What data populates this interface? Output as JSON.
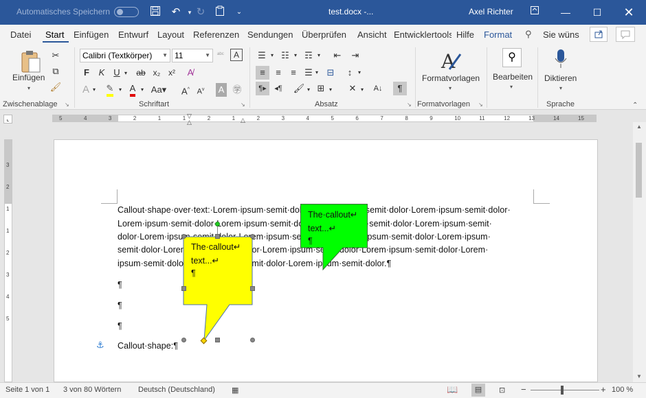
{
  "titlebar": {
    "autosave_label": "Automatisches Speichern",
    "doc_title": "test.docx  -...",
    "user_name": "Axel Richter",
    "bg_color": "#2b579a"
  },
  "tabs": [
    "Datei",
    "Start",
    "Einfügen",
    "Entwurf",
    "Layout",
    "Referenzen",
    "Sendungen",
    "Überprüfen",
    "Ansicht",
    "Entwicklertools",
    "Hilfe",
    "Format"
  ],
  "active_tab": "Start",
  "search_label": "Sie wüns",
  "ribbon": {
    "clipboard": {
      "paste_label": "Einfügen",
      "group_label": "Zwischenablage"
    },
    "font": {
      "font_name": "Calibri (Textkörper)",
      "font_size": "11",
      "group_label": "Schriftart"
    },
    "paragraph": {
      "group_label": "Absatz"
    },
    "styles": {
      "button_label": "Formatvorlagen",
      "group_label": "Formatvorlagen"
    },
    "editing": {
      "button_label": "Bearbeiten"
    },
    "voice": {
      "button_label": "Diktieren",
      "group_label": "Sprache"
    }
  },
  "ruler": {
    "h_marks": [
      "5",
      "4",
      "3",
      "2",
      "1",
      "1",
      "2",
      "1",
      "2",
      "3",
      "4",
      "5",
      "6",
      "7",
      "8",
      "9",
      "10",
      "11",
      "12",
      "13",
      "14",
      "15"
    ],
    "v_marks": [
      "3",
      "2",
      "1",
      "1",
      "2",
      "3",
      "4",
      "5"
    ]
  },
  "document": {
    "lines": [
      "Callout·shape·over·text:·Lorem·ipsum·semit·dolor·Lorem·ipsum·semit·dolor·Lorem·ipsum·semit·dolor·",
      "Lorem·ipsum·semit·dolor·Lorem·ipsum·semit·dolor·Lorem·ipsum·semit·dolor·Lorem·ipsum·semit·",
      "dolor·Lorem·ipsum·semit·dolor·Lorem·ipsum·semit·dolor·Lorem·ipsum·semit·dolor·Lorem·ipsum·",
      "semit·dolor·Lorem·ipsum·semit·dolor·Lorem·ipsum·semit·dolor·Lorem·ipsum·semit·dolor·Lorem·",
      "ipsum·semit·dolor·Lorem·ipsum·semit·dolor·Lorem·ipsum·semit·dolor.¶"
    ],
    "empty_para": "¶",
    "last_para": "Callout·shape:¶",
    "anchor_symbol": "⚓",
    "green_callout": {
      "line1": "The·callout↵",
      "line2": "text...↵",
      "line3": "¶",
      "color": "#00ff00"
    },
    "yellow_callout": {
      "line1": "The·callout↵",
      "line2": "text...↵",
      "line3": "¶",
      "color": "#ffff00"
    }
  },
  "statusbar": {
    "page": "Seite 1 von 1",
    "words": "3 von 80 Wörtern",
    "language": "Deutsch (Deutschland)",
    "zoom": "100 %",
    "zoom_minus": "−",
    "zoom_plus": "+"
  }
}
